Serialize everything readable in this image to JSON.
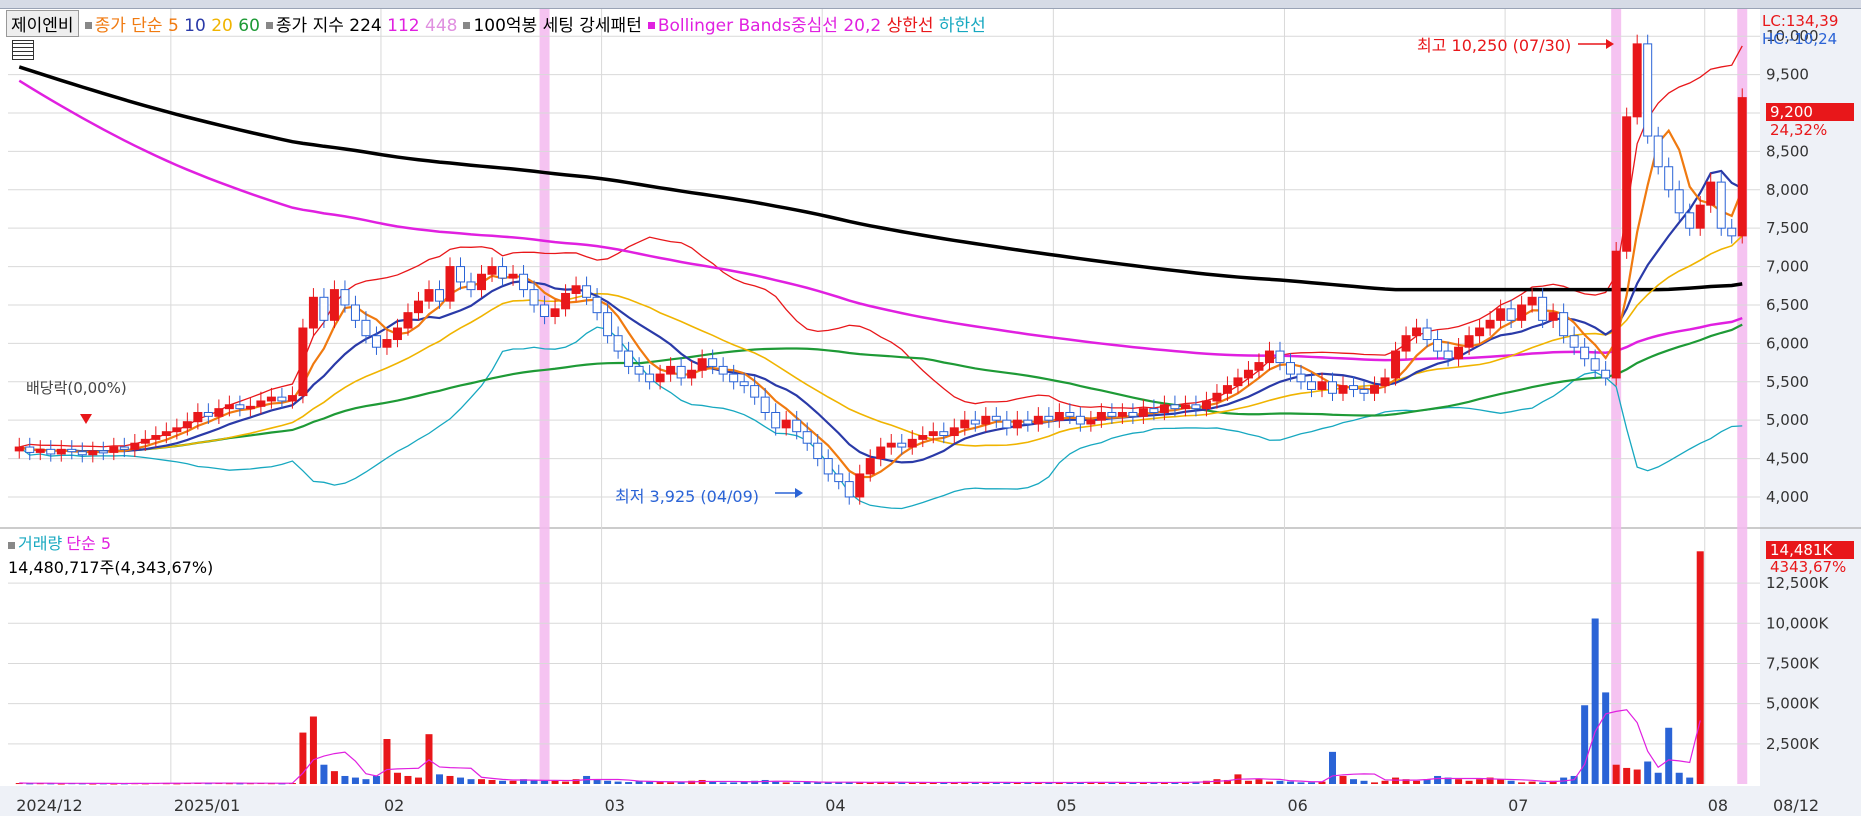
{
  "legend": {
    "ticker": "제이엔비",
    "ma_label": "종가 단순",
    "ma_periods": [
      "5",
      "10",
      "20",
      "60"
    ],
    "ma_colors": [
      "#f07a10",
      "#2a3aa8",
      "#f0b400",
      "#1e9a36"
    ],
    "long_label": "종가 지수",
    "long_periods": [
      "224",
      "112",
      "448"
    ],
    "long_colors": [
      "#000000",
      "#e020e0",
      "#e090e0"
    ],
    "pattern": "100억봉 세팅 강세패턴",
    "bb_label": "Bollinger Bands중심선 20,2",
    "bb_upper": "상한선",
    "bb_lower": "하한선",
    "bb_colors": [
      "#e020e0",
      "#e8171a",
      "#17a8c0"
    ]
  },
  "price_axis": {
    "lc": "LC:134,39",
    "hc": "HC:-10,24",
    "current": "9,200",
    "current_pct": "24,32%"
  },
  "volume_legend": {
    "label": "거래량",
    "ma": "단순 5",
    "value": "14,480,717주(4,343,67%)"
  },
  "volume_axis": {
    "current": "14,481K",
    "current_pct": "4343,67%"
  },
  "annotations": {
    "high": "최고 10,250 (07/30)",
    "low": "최저 3,925 (04/09)",
    "dividend": "배당락(0,00%)"
  },
  "colors": {
    "up": "#e8171a",
    "down": "#2a63d6",
    "grid": "#d9d9d9",
    "highlight": "#f3b8ef",
    "axis_bg": "#eef1f7"
  },
  "chart_data": {
    "type": "candlestick",
    "x_labels": [
      "2024/12",
      "2025/01",
      "02",
      "03",
      "04",
      "05",
      "06",
      "07",
      "08",
      "08/12"
    ],
    "price_ticks": [
      "4,000",
      "4,500",
      "5,000",
      "5,500",
      "6,000",
      "6,500",
      "7,000",
      "7,500",
      "8,000",
      "8,500",
      "9,000",
      "9,500",
      "10,000"
    ],
    "price_range": [
      3700,
      10250
    ],
    "volume_ticks": [
      "2,500K",
      "5,000K",
      "7,500K",
      "10,000K",
      "12,500K"
    ],
    "volume_range": [
      0,
      14500
    ],
    "n_bars": 166,
    "events": [
      {
        "index": 50,
        "label": "volume surge"
      },
      {
        "index": 152,
        "label": "volume surge"
      },
      {
        "index": 164,
        "label": "volume surge"
      }
    ],
    "candles": [
      {
        "d": 0,
        "o": 4600,
        "c": 4650
      },
      {
        "d": 1,
        "o": 4650,
        "c": 4580
      },
      {
        "d": 2,
        "o": 4580,
        "c": 4620
      },
      {
        "d": 3,
        "o": 4620,
        "c": 4560
      },
      {
        "d": 4,
        "o": 4560,
        "c": 4620
      },
      {
        "d": 5,
        "o": 4620,
        "c": 4590
      },
      {
        "d": 6,
        "o": 4590,
        "c": 4550
      },
      {
        "d": 7,
        "o": 4550,
        "c": 4600
      },
      {
        "d": 8,
        "o": 4600,
        "c": 4580
      },
      {
        "d": 9,
        "o": 4580,
        "c": 4650
      },
      {
        "d": 10,
        "o": 4650,
        "c": 4620
      },
      {
        "d": 11,
        "o": 4620,
        "c": 4700
      },
      {
        "d": 12,
        "o": 4700,
        "c": 4750
      },
      {
        "d": 13,
        "o": 4750,
        "c": 4800
      },
      {
        "d": 14,
        "o": 4800,
        "c": 4850
      },
      {
        "d": 15,
        "o": 4850,
        "c": 4900
      },
      {
        "d": 16,
        "o": 4900,
        "c": 4980
      },
      {
        "d": 17,
        "o": 4980,
        "c": 5100
      },
      {
        "d": 18,
        "o": 5100,
        "c": 5050
      },
      {
        "d": 19,
        "o": 5050,
        "c": 5150
      },
      {
        "d": 20,
        "o": 5150,
        "c": 5200
      },
      {
        "d": 21,
        "o": 5200,
        "c": 5150
      },
      {
        "d": 22,
        "o": 5150,
        "c": 5180
      },
      {
        "d": 23,
        "o": 5180,
        "c": 5250
      },
      {
        "d": 24,
        "o": 5250,
        "c": 5300
      },
      {
        "d": 25,
        "o": 5300,
        "c": 5250
      },
      {
        "d": 26,
        "o": 5250,
        "c": 5320
      },
      {
        "d": 27,
        "o": 5320,
        "c": 6200
      },
      {
        "d": 28,
        "o": 6200,
        "c": 6600
      },
      {
        "d": 29,
        "o": 6600,
        "c": 6300
      },
      {
        "d": 30,
        "o": 6300,
        "c": 6700
      },
      {
        "d": 31,
        "o": 6700,
        "c": 6500
      },
      {
        "d": 32,
        "o": 6500,
        "c": 6300
      },
      {
        "d": 33,
        "o": 6300,
        "c": 6100
      },
      {
        "d": 34,
        "o": 6100,
        "c": 5950
      },
      {
        "d": 35,
        "o": 5950,
        "c": 6050
      },
      {
        "d": 36,
        "o": 6050,
        "c": 6200
      },
      {
        "d": 37,
        "o": 6200,
        "c": 6400
      },
      {
        "d": 38,
        "o": 6400,
        "c": 6550
      },
      {
        "d": 39,
        "o": 6550,
        "c": 6700
      },
      {
        "d": 40,
        "o": 6700,
        "c": 6550
      },
      {
        "d": 41,
        "o": 6550,
        "c": 7000
      },
      {
        "d": 42,
        "o": 7000,
        "c": 6800
      },
      {
        "d": 43,
        "o": 6800,
        "c": 6700
      },
      {
        "d": 44,
        "o": 6700,
        "c": 6900
      },
      {
        "d": 45,
        "o": 6900,
        "c": 7000
      },
      {
        "d": 46,
        "o": 7000,
        "c": 6850
      },
      {
        "d": 47,
        "o": 6850,
        "c": 6900
      },
      {
        "d": 48,
        "o": 6900,
        "c": 6700
      },
      {
        "d": 49,
        "o": 6700,
        "c": 6500
      },
      {
        "d": 50,
        "o": 6500,
        "c": 6350
      },
      {
        "d": 51,
        "o": 6350,
        "c": 6450
      },
      {
        "d": 52,
        "o": 6450,
        "c": 6650
      },
      {
        "d": 53,
        "o": 6650,
        "c": 6750
      },
      {
        "d": 54,
        "o": 6750,
        "c": 6600
      },
      {
        "d": 55,
        "o": 6600,
        "c": 6400
      },
      {
        "d": 56,
        "o": 6400,
        "c": 6100
      },
      {
        "d": 57,
        "o": 6100,
        "c": 5900
      },
      {
        "d": 58,
        "o": 5900,
        "c": 5700
      },
      {
        "d": 59,
        "o": 5700,
        "c": 5600
      },
      {
        "d": 60,
        "o": 5600,
        "c": 5500
      },
      {
        "d": 61,
        "o": 5500,
        "c": 5600
      },
      {
        "d": 62,
        "o": 5600,
        "c": 5700
      },
      {
        "d": 63,
        "o": 5700,
        "c": 5550
      },
      {
        "d": 64,
        "o": 5550,
        "c": 5650
      },
      {
        "d": 65,
        "o": 5650,
        "c": 5800
      },
      {
        "d": 66,
        "o": 5800,
        "c": 5700
      },
      {
        "d": 67,
        "o": 5700,
        "c": 5600
      },
      {
        "d": 68,
        "o": 5600,
        "c": 5500
      },
      {
        "d": 69,
        "o": 5500,
        "c": 5450
      },
      {
        "d": 70,
        "o": 5450,
        "c": 5300
      },
      {
        "d": 71,
        "o": 5300,
        "c": 5100
      },
      {
        "d": 72,
        "o": 5100,
        "c": 4900
      },
      {
        "d": 73,
        "o": 4900,
        "c": 5000
      },
      {
        "d": 74,
        "o": 5000,
        "c": 4850
      },
      {
        "d": 75,
        "o": 4850,
        "c": 4700
      },
      {
        "d": 76,
        "o": 4700,
        "c": 4500
      },
      {
        "d": 77,
        "o": 4500,
        "c": 4300
      },
      {
        "d": 78,
        "o": 4300,
        "c": 4200
      },
      {
        "d": 79,
        "o": 4200,
        "c": 4000
      },
      {
        "d": 80,
        "o": 4000,
        "c": 4300
      },
      {
        "d": 81,
        "o": 4300,
        "c": 4500
      },
      {
        "d": 82,
        "o": 4500,
        "c": 4650
      },
      {
        "d": 83,
        "o": 4650,
        "c": 4700
      },
      {
        "d": 84,
        "o": 4700,
        "c": 4650
      },
      {
        "d": 85,
        "o": 4650,
        "c": 4750
      },
      {
        "d": 86,
        "o": 4750,
        "c": 4800
      },
      {
        "d": 87,
        "o": 4800,
        "c": 4850
      },
      {
        "d": 88,
        "o": 4850,
        "c": 4800
      },
      {
        "d": 89,
        "o": 4800,
        "c": 4900
      },
      {
        "d": 90,
        "o": 4900,
        "c": 5000
      },
      {
        "d": 91,
        "o": 5000,
        "c": 4950
      },
      {
        "d": 92,
        "o": 4950,
        "c": 5050
      },
      {
        "d": 93,
        "o": 5050,
        "c": 5000
      },
      {
        "d": 94,
        "o": 5000,
        "c": 4900
      },
      {
        "d": 95,
        "o": 4900,
        "c": 5000
      },
      {
        "d": 96,
        "o": 5000,
        "c": 4950
      },
      {
        "d": 97,
        "o": 4950,
        "c": 5050
      },
      {
        "d": 98,
        "o": 5050,
        "c": 5000
      },
      {
        "d": 99,
        "o": 5000,
        "c": 5100
      },
      {
        "d": 100,
        "o": 5100,
        "c": 5050
      },
      {
        "d": 101,
        "o": 5050,
        "c": 4950
      },
      {
        "d": 102,
        "o": 4950,
        "c": 5000
      },
      {
        "d": 103,
        "o": 5000,
        "c": 5100
      },
      {
        "d": 104,
        "o": 5100,
        "c": 5050
      },
      {
        "d": 105,
        "o": 5050,
        "c": 5100
      },
      {
        "d": 106,
        "o": 5100,
        "c": 5050
      },
      {
        "d": 107,
        "o": 5050,
        "c": 5150
      },
      {
        "d": 108,
        "o": 5150,
        "c": 5100
      },
      {
        "d": 109,
        "o": 5100,
        "c": 5200
      },
      {
        "d": 110,
        "o": 5200,
        "c": 5150
      },
      {
        "d": 111,
        "o": 5150,
        "c": 5200
      },
      {
        "d": 112,
        "o": 5200,
        "c": 5150
      },
      {
        "d": 113,
        "o": 5150,
        "c": 5250
      },
      {
        "d": 114,
        "o": 5250,
        "c": 5350
      },
      {
        "d": 115,
        "o": 5350,
        "c": 5450
      },
      {
        "d": 116,
        "o": 5450,
        "c": 5550
      },
      {
        "d": 117,
        "o": 5550,
        "c": 5650
      },
      {
        "d": 118,
        "o": 5650,
        "c": 5750
      },
      {
        "d": 119,
        "o": 5750,
        "c": 5900
      },
      {
        "d": 120,
        "o": 5900,
        "c": 5750
      },
      {
        "d": 121,
        "o": 5750,
        "c": 5600
      },
      {
        "d": 122,
        "o": 5600,
        "c": 5500
      },
      {
        "d": 123,
        "o": 5500,
        "c": 5400
      },
      {
        "d": 124,
        "o": 5400,
        "c": 5500
      },
      {
        "d": 125,
        "o": 5500,
        "c": 5350
      },
      {
        "d": 126,
        "o": 5350,
        "c": 5450
      },
      {
        "d": 127,
        "o": 5450,
        "c": 5400
      },
      {
        "d": 128,
        "o": 5400,
        "c": 5350
      },
      {
        "d": 129,
        "o": 5350,
        "c": 5450
      },
      {
        "d": 130,
        "o": 5450,
        "c": 5550
      },
      {
        "d": 131,
        "o": 5550,
        "c": 5900
      },
      {
        "d": 132,
        "o": 5900,
        "c": 6100
      },
      {
        "d": 133,
        "o": 6100,
        "c": 6200
      },
      {
        "d": 134,
        "o": 6200,
        "c": 6050
      },
      {
        "d": 135,
        "o": 6050,
        "c": 5900
      },
      {
        "d": 136,
        "o": 5900,
        "c": 5800
      },
      {
        "d": 137,
        "o": 5800,
        "c": 5950
      },
      {
        "d": 138,
        "o": 5950,
        "c": 6100
      },
      {
        "d": 139,
        "o": 6100,
        "c": 6200
      },
      {
        "d": 140,
        "o": 6200,
        "c": 6300
      },
      {
        "d": 141,
        "o": 6300,
        "c": 6450
      },
      {
        "d": 142,
        "o": 6450,
        "c": 6300
      },
      {
        "d": 143,
        "o": 6300,
        "c": 6500
      },
      {
        "d": 144,
        "o": 6500,
        "c": 6600
      },
      {
        "d": 145,
        "o": 6600,
        "c": 6300
      },
      {
        "d": 146,
        "o": 6300,
        "c": 6400
      },
      {
        "d": 147,
        "o": 6400,
        "c": 6100
      },
      {
        "d": 148,
        "o": 6100,
        "c": 5950
      },
      {
        "d": 149,
        "o": 5950,
        "c": 5800
      },
      {
        "d": 150,
        "o": 5800,
        "c": 5650
      },
      {
        "d": 151,
        "o": 5650,
        "c": 5550
      },
      {
        "d": 152,
        "o": 5550,
        "c": 7200
      },
      {
        "d": 153,
        "o": 7200,
        "c": 8950
      },
      {
        "d": 154,
        "o": 8950,
        "c": 9900
      },
      {
        "d": 155,
        "o": 9900,
        "c": 8700
      },
      {
        "d": 156,
        "o": 8700,
        "c": 8300
      },
      {
        "d": 157,
        "o": 8300,
        "c": 8000
      },
      {
        "d": 158,
        "o": 8000,
        "c": 7700
      },
      {
        "d": 159,
        "o": 7700,
        "c": 7500
      },
      {
        "d": 160,
        "o": 7500,
        "c": 7800
      },
      {
        "d": 161,
        "o": 7800,
        "c": 8100
      },
      {
        "d": 162,
        "o": 8100,
        "c": 7500
      },
      {
        "d": 163,
        "o": 7500,
        "c": 7400
      },
      {
        "d": 164,
        "o": 7400,
        "c": 9200
      }
    ],
    "volume": [
      60,
      40,
      50,
      40,
      30,
      50,
      40,
      30,
      40,
      30,
      40,
      50,
      40,
      60,
      50,
      40,
      60,
      70,
      50,
      60,
      50,
      40,
      50,
      60,
      50,
      40,
      60,
      3200,
      4200,
      1200,
      800,
      500,
      400,
      300,
      500,
      2800,
      700,
      500,
      400,
      3100,
      600,
      500,
      400,
      300,
      300,
      250,
      200,
      200,
      300,
      250,
      200,
      200,
      150,
      300,
      500,
      250,
      200,
      150,
      120,
      200,
      150,
      120,
      100,
      100,
      200,
      250,
      150,
      100,
      100,
      150,
      200,
      250,
      150,
      100,
      100,
      150,
      120,
      100,
      100,
      100,
      120,
      100,
      120,
      100,
      100,
      90,
      90,
      100,
      100,
      90,
      120,
      100,
      100,
      100,
      90,
      90,
      100,
      90,
      100,
      90,
      90,
      120,
      100,
      100,
      90,
      100,
      90,
      100,
      90,
      100,
      100,
      120,
      150,
      200,
      300,
      250,
      600,
      200,
      300,
      150,
      200,
      150,
      100,
      100,
      150,
      2000,
      500,
      300,
      200,
      100,
      200,
      400,
      300,
      200,
      300,
      500,
      400,
      300,
      200,
      300,
      400,
      300,
      200,
      100,
      150,
      100,
      200,
      400,
      500,
      4900,
      10300,
      5700,
      1200,
      1000,
      900,
      1400,
      700,
      3500,
      700,
      400,
      14481
    ]
  }
}
